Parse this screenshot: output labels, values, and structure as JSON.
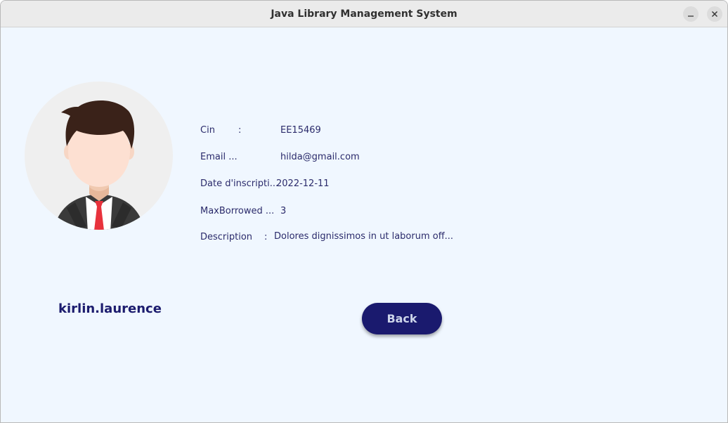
{
  "window": {
    "title": "Java Library Management System",
    "minimize_icon": "minimize-icon",
    "close_icon": "close-icon"
  },
  "profile": {
    "username": "kirlin.laurence",
    "avatar_icon": "user-avatar-icon"
  },
  "details": {
    "cin": {
      "label": "Cin",
      "sep": ":",
      "value": "EE15469"
    },
    "email": {
      "label": "Email  ...",
      "value": "hilda@gmail.com"
    },
    "date": {
      "label": "Date d'inscripti...",
      "value": "2022-12-11"
    },
    "maxborrowed": {
      "label": "MaxBorrowed  ...",
      "value": "3"
    },
    "description": {
      "label": "Description",
      "sep": ":",
      "value": "Dolores dignissimos in ut laborum off..."
    }
  },
  "actions": {
    "back_label": "Back"
  },
  "colors": {
    "background": "#f0f7ff",
    "text": "#2b2b6b",
    "accent": "#1a1a6e"
  }
}
